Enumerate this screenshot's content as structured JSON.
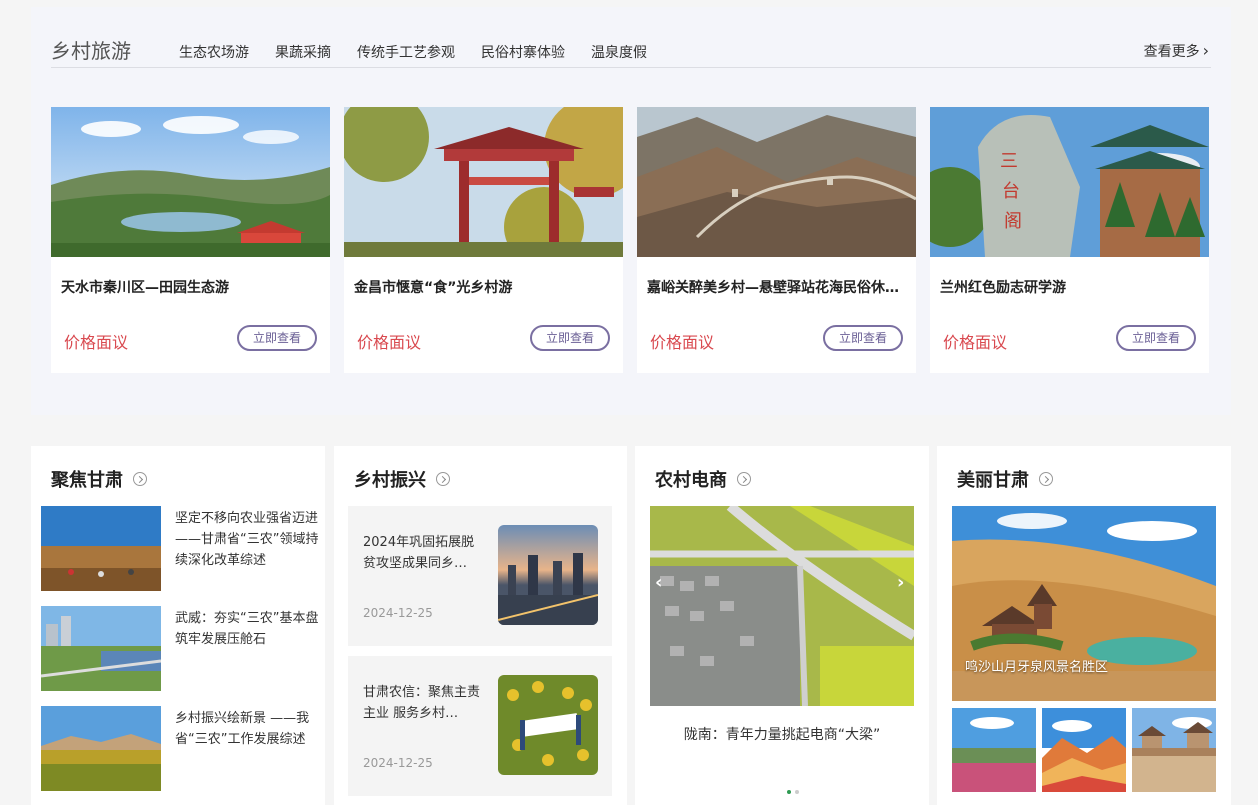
{
  "tourism": {
    "title": "乡村旅游",
    "tabs": [
      "生态农场游",
      "果蔬采摘",
      "传统手工艺参观",
      "民俗村寨体验",
      "温泉度假"
    ],
    "more": "查看更多",
    "cards": [
      {
        "title": "天水市秦川区—田园生态游",
        "price": "价格面议",
        "button": "立即查看"
      },
      {
        "title": "金昌市惬意“食”光乡村游",
        "price": "价格面议",
        "button": "立即查看"
      },
      {
        "title": "嘉峪关醉美乡村—悬壁驿站花海民俗休闲游",
        "price": "价格面议",
        "button": "立即查看"
      },
      {
        "title": "兰州红色励志研学游",
        "price": "价格面议",
        "button": "立即查看"
      }
    ]
  },
  "focus": {
    "title": "聚焦甘肃",
    "items": [
      {
        "text": "坚定不移向农业强省迈进 ——甘肃省“三农”领域持续深化改革综述"
      },
      {
        "text": "武威：夯实“三农”基本盘 筑牢发展压舱石"
      },
      {
        "text": "乡村振兴绘新景 ——我省“三农”工作发展综述"
      }
    ]
  },
  "revitalize": {
    "title": "乡村振兴",
    "items": [
      {
        "text": "2024年巩固拓展脱贫攻坚成果同乡…",
        "date": "2024-12-25"
      },
      {
        "text": "甘肃农信：聚焦主责主业 服务乡村…",
        "date": "2024-12-25"
      }
    ]
  },
  "ecommerce": {
    "title": "农村电商",
    "caption": "陇南：青年力量挑起电商“大梁”",
    "prev": "‹",
    "next": "›"
  },
  "beauty": {
    "title": "美丽甘肃",
    "caption": "鸣沙山月牙泉风景名胜区"
  }
}
